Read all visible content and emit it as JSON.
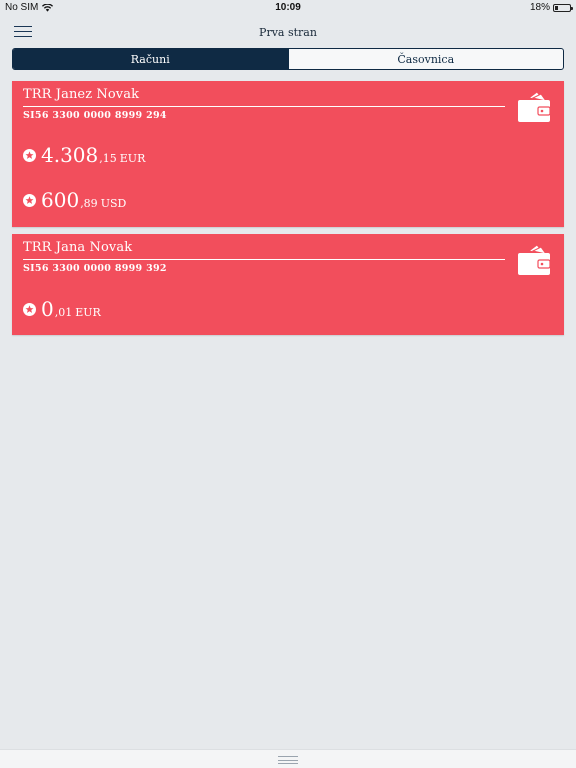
{
  "status": {
    "carrier": "No SIM",
    "time": "10:09",
    "battery": "18%",
    "battery_level": 0.18
  },
  "nav": {
    "title": "Prva stran"
  },
  "tabs": [
    {
      "label": "Računi",
      "active": true
    },
    {
      "label": "Časovnica",
      "active": false
    }
  ],
  "accounts": [
    {
      "name": "TRR Janez Novak",
      "iban": "SI56 3300 0000 8999 294",
      "balances": [
        {
          "integer": "4.308",
          "decimal": ",15",
          "currency": "EUR"
        },
        {
          "integer": "600",
          "decimal": ",89",
          "currency": "USD"
        }
      ]
    },
    {
      "name": "TRR Jana Novak",
      "iban": "SI56 3300 0000 8999 392",
      "balances": [
        {
          "integer": "0",
          "decimal": ",01",
          "currency": "EUR"
        }
      ]
    }
  ],
  "colors": {
    "card": "#f24e5c",
    "primary": "#0f2a44",
    "background": "#e6e9ec"
  },
  "icons": {
    "menu": "hamburger-icon",
    "wallet": "wallet-icon",
    "favorite": "star-icon",
    "handle": "drag-handle-icon"
  }
}
